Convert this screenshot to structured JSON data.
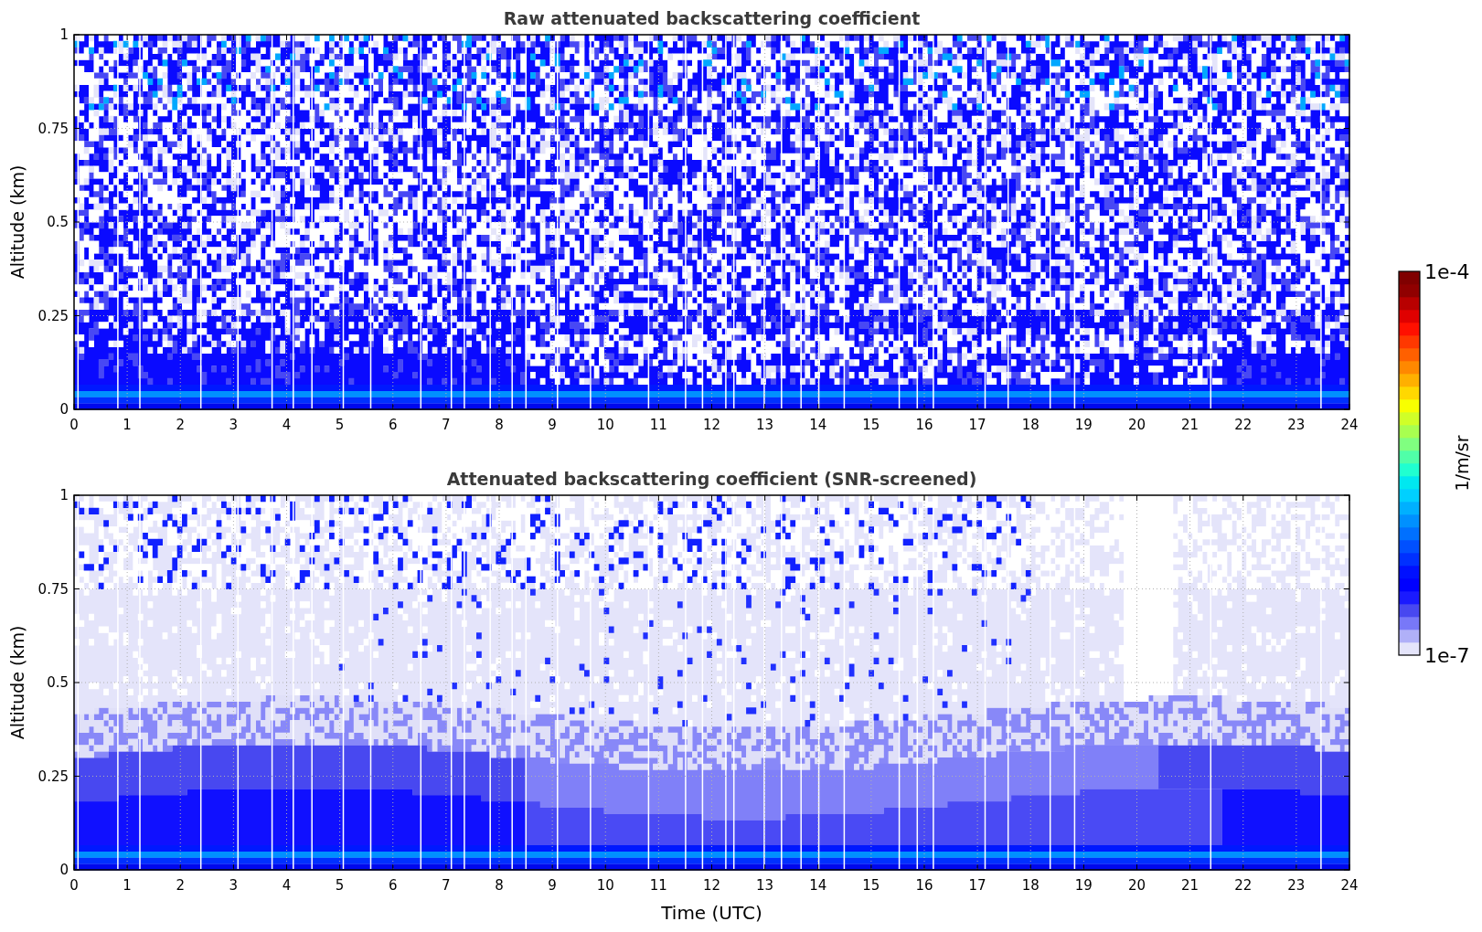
{
  "panels": [
    {
      "kind": "raw",
      "title": "Raw attenuated backscattering coefficient",
      "ylabel": "Altitude (km)",
      "yticks": [
        "1",
        "0.75",
        "0.5",
        "0.25",
        "0"
      ],
      "xticks": [
        "0",
        "1",
        "2",
        "3",
        "4",
        "5",
        "6",
        "7",
        "8",
        "9",
        "10",
        "11",
        "12",
        "13",
        "14",
        "15",
        "16",
        "17",
        "18",
        "19",
        "20",
        "21",
        "22",
        "23",
        "24"
      ]
    },
    {
      "kind": "screened",
      "title": "Attenuated backscattering coefficient (SNR-screened)",
      "ylabel": "Altitude (km)",
      "yticks": [
        "1",
        "0.75",
        "0.5",
        "0.25",
        "0"
      ],
      "xticks": [
        "0",
        "1",
        "2",
        "3",
        "4",
        "5",
        "6",
        "7",
        "8",
        "9",
        "10",
        "11",
        "12",
        "13",
        "14",
        "15",
        "16",
        "17",
        "18",
        "19",
        "20",
        "21",
        "22",
        "23",
        "24"
      ],
      "xlabel": "Time (UTC)"
    }
  ],
  "colorbar": {
    "label": "1/m/sr",
    "max_label": "1e-4",
    "min_label": "1e-7"
  }
}
